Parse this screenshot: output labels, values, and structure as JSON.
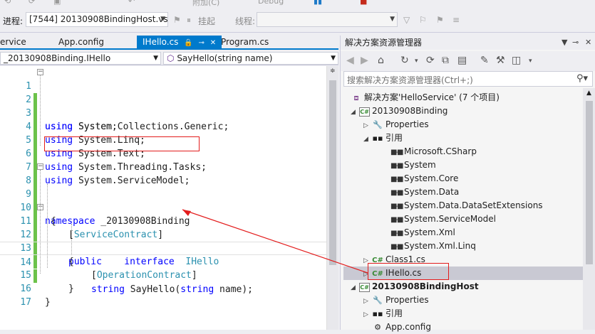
{
  "toolbar": {
    "partial_attach": "附加(C)",
    "partial_debug": "Debug",
    "process_label": "进程:",
    "process_value": "[7544] 20130908BindingHost.vs",
    "suspend_label": "挂起",
    "thread_label": "线程:"
  },
  "tabs": [
    {
      "label": "ervice"
    },
    {
      "label": "App.config"
    },
    {
      "label": "IHello.cs"
    },
    {
      "label": "Program.cs"
    }
  ],
  "nav": {
    "type_combo": "_20130908Binding.IHello",
    "member_combo": "SayHello(string name)"
  },
  "editor": {
    "line_numbers": [
      "1",
      "2",
      "3",
      "4",
      "5",
      "6",
      "7",
      "8",
      "9",
      "10",
      "11",
      "12",
      "13",
      "14",
      "15",
      "16",
      "17"
    ],
    "lines": [
      {
        "kw": "using",
        "rest": " System;"
      },
      {
        "kw": "using",
        "rest": " System.Collections.Generic;"
      },
      {
        "kw": "using",
        "rest": " System.Linq;"
      },
      {
        "kw": "using",
        "rest": " System.Text;"
      },
      {
        "kw": "using",
        "rest": " System.Threading.Tasks;"
      },
      {
        "kw": "using",
        "rest": " System.ServiceModel;"
      },
      {
        "kw": "",
        "rest": ""
      },
      {
        "kw": "namespace",
        "rest": " _20130908Binding"
      },
      {
        "kw": "",
        "rest": " {"
      },
      {
        "open": "[",
        "type": "ServiceContract",
        "close": "]"
      },
      {
        "kw1": "public",
        "kw2": "interface",
        "type": "IHello"
      },
      {
        "rest": "{"
      },
      {
        "open": "[",
        "type": "OperationContract",
        "close": "]"
      },
      {
        "kw": "string",
        "mid": " SayHello(",
        "kw2": "string",
        "end": " name);"
      },
      {
        "rest": "}"
      },
      {
        "rest": "}"
      },
      {
        "rest": ""
      }
    ]
  },
  "solution_explorer": {
    "title": "解决方案资源管理器",
    "search_placeholder": "搜索解决方案资源管理器(Ctrl+;)",
    "nodes": [
      {
        "label": "解决方案'HelloService' (7 个项目)"
      },
      {
        "label": "20130908Binding"
      },
      {
        "label": "Properties"
      },
      {
        "label": "引用"
      },
      {
        "label": "Microsoft.CSharp"
      },
      {
        "label": "System"
      },
      {
        "label": "System.Core"
      },
      {
        "label": "System.Data"
      },
      {
        "label": "System.Data.DataSetExtensions"
      },
      {
        "label": "System.ServiceModel"
      },
      {
        "label": "System.Xml"
      },
      {
        "label": "System.Xml.Linq"
      },
      {
        "label": "Class1.cs"
      },
      {
        "label": "IHello.cs"
      },
      {
        "label": "20130908BindingHost"
      },
      {
        "label": "Properties"
      },
      {
        "label": "引用"
      },
      {
        "label": "App.config"
      }
    ]
  },
  "colors": {
    "accent": "#007acc",
    "annotation_red": "#e31c1c",
    "keyword": "#0000ff",
    "type": "#2b91af"
  }
}
